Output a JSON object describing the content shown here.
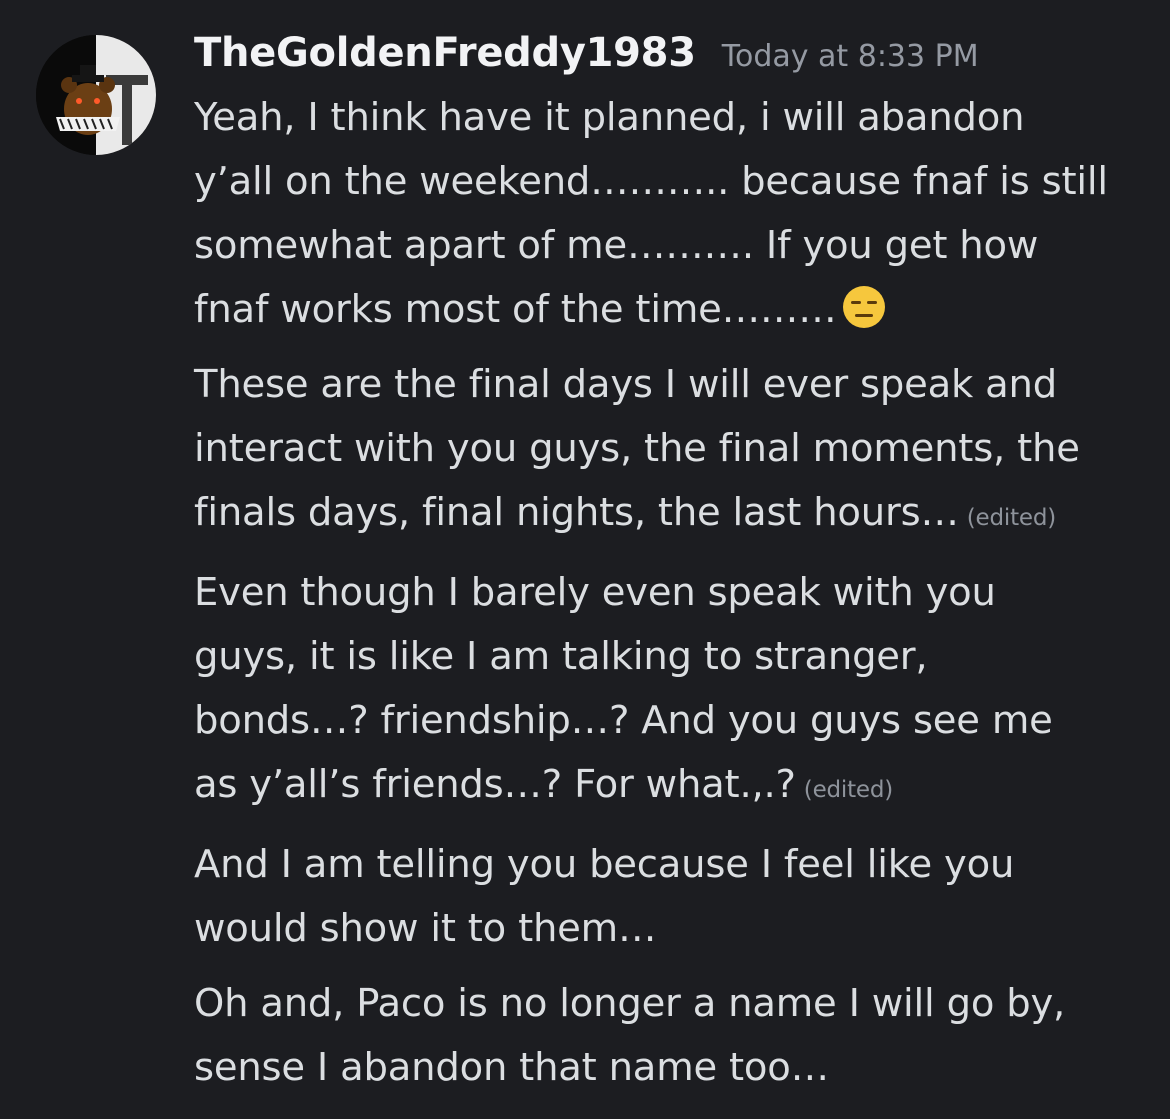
{
  "message": {
    "author": {
      "name": "TheGoldenFreddy1983",
      "avatar_icon": "golden-freddy-avatar-icon"
    },
    "timestamp": "Today at 8:33 PM",
    "edited_label": "(edited)",
    "messages": [
      {
        "lines": [
          "Yeah, I think have it planned, i will abandon",
          "y’all on the weekend……….. because fnaf is still",
          "somewhat apart of me………. If you get how",
          "fnaf works most of the time………"
        ],
        "emoji": "expressionless-face-emoji"
      },
      {
        "lines": [
          "These are the final days I will ever speak and",
          "interact with you guys, the final moments, the",
          "finals days, final nights, the last hours…"
        ],
        "edited": true
      },
      {
        "lines": [
          "Even though I barely even speak with you",
          "guys, it is like I am talking to stranger,",
          "bonds…? friendship…? And you guys see me",
          "as y’all’s friends…? For what.,.?"
        ],
        "edited": true
      },
      {
        "lines": [
          "And I am telling you because I feel like you",
          "would show it to them…"
        ]
      },
      {
        "lines": [
          "Oh and, Paco is no longer a name I will go by,",
          "sense I abandon that name too…"
        ]
      }
    ]
  },
  "colors": {
    "background": "#1c1d21",
    "username": "#f2f3f5",
    "text": "#dbdee1",
    "timestamp": "#959aa3",
    "edited": "#8e939b",
    "emoji_face": "#f6c73d"
  }
}
